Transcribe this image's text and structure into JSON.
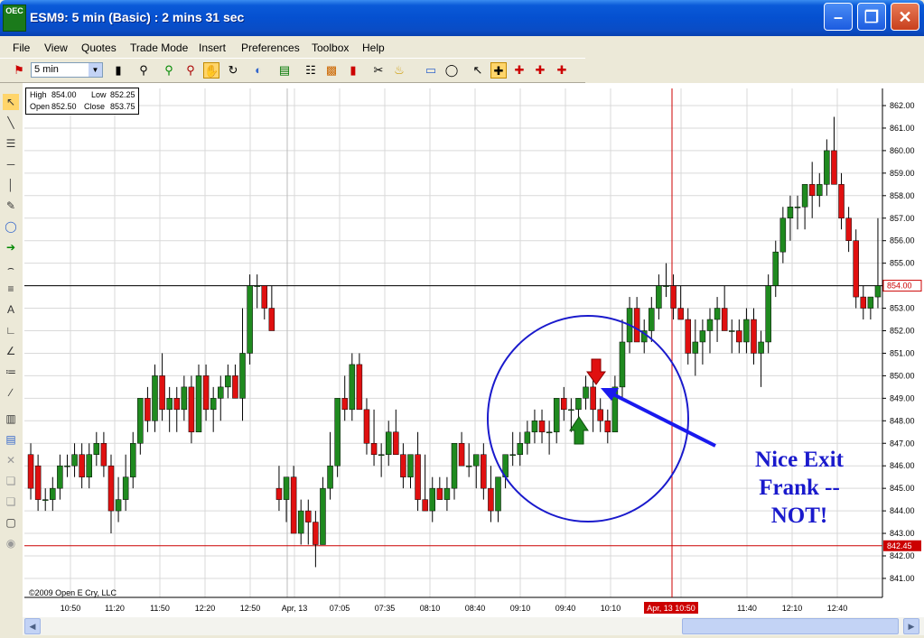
{
  "window": {
    "title": "ESM9: 5 min (Basic) : 2 mins 31 sec",
    "app_icon": "OEC",
    "minimize_label": "–",
    "maximize_label": "❐",
    "close_label": "✕"
  },
  "menu": [
    "File",
    "View",
    "Quotes",
    "Trade Mode",
    "Insert",
    "Preferences",
    "Toolbox",
    "Help"
  ],
  "toolbar": {
    "interval_value": "5 min",
    "icons": [
      "pin-icon",
      "bar-type-icon",
      "zoom-icon",
      "zoom-in-icon",
      "zoom-out-icon",
      "pan-hand-icon",
      "refresh-icon",
      "3d-icon",
      "indicator-icon",
      "tree-icon",
      "color-bars-icon",
      "histogram-icon",
      "cut-icon",
      "bell-icon",
      "trash-icon",
      "mouse-icon",
      "pointer-icon",
      "crosshair-icon",
      "crosshair-red-icon",
      "crosshair-red2-icon"
    ]
  },
  "ohlc": {
    "high_label": "High",
    "high_value": "854.00",
    "low_label": "Low",
    "low_value": "852.25",
    "open_label": "Open",
    "open_value": "852.50",
    "close_label": "Close",
    "close_value": "853.75"
  },
  "copyright": "©2009 Open E Cry, LLC",
  "annotation": [
    "Nice Exit",
    "Frank --",
    "NOT!"
  ],
  "colors": {
    "up": "#1f8a1f",
    "down": "#e01010",
    "grid": "#d9d9d9",
    "crosshair": "#cc0000",
    "annotation": "#1a1acc",
    "arrow": "#1a1aee"
  },
  "chart_data": {
    "type": "candlestick",
    "symbol": "ESM9",
    "interval": "5 min",
    "y_ticks": [
      "862.00",
      "861.00",
      "860.00",
      "859.00",
      "858.00",
      "857.00",
      "856.00",
      "855.00",
      "854.00",
      "853.00",
      "852.00",
      "851.00",
      "850.00",
      "849.00",
      "848.00",
      "847.00",
      "846.00",
      "845.00",
      "844.00",
      "843.00",
      "842.00",
      "841.00"
    ],
    "ylim": [
      840.5,
      862.5
    ],
    "x_ticks": [
      "10:50",
      "11:20",
      "11:50",
      "12:20",
      "12:50",
      "Apr, 13",
      "07:05",
      "07:35",
      "08:10",
      "08:40",
      "09:10",
      "09:40",
      "10:10",
      "10:50",
      "11:40",
      "12:10",
      "12:40"
    ],
    "x_cursor_label": "Apr, 13 10:50",
    "price_line": 854.0,
    "price_line_label": "854.00",
    "cursor_price": 842.45,
    "cursor_price_label": "842.45",
    "candles": [
      [
        846.5,
        847.0,
        844.5,
        845.0
      ],
      [
        846.0,
        846.5,
        844.0,
        844.5
      ],
      [
        844.5,
        845.0,
        844.0,
        844.5
      ],
      [
        844.5,
        845.5,
        844.0,
        845.0
      ],
      [
        845.0,
        846.5,
        844.5,
        846.0
      ],
      [
        846.0,
        846.5,
        845.5,
        846.0
      ],
      [
        846.0,
        847.0,
        845.5,
        846.5
      ],
      [
        846.5,
        847.0,
        845.0,
        845.5
      ],
      [
        845.5,
        847.0,
        845.0,
        846.5
      ],
      [
        846.5,
        847.5,
        846.0,
        847.0
      ],
      [
        847.0,
        847.5,
        845.5,
        846.0
      ],
      [
        846.0,
        846.5,
        843.0,
        844.0
      ],
      [
        844.0,
        845.5,
        843.5,
        844.5
      ],
      [
        844.5,
        846.5,
        844.0,
        845.5
      ],
      [
        845.5,
        847.5,
        845.0,
        847.0
      ],
      [
        847.0,
        849.0,
        846.5,
        849.0
      ],
      [
        849.0,
        849.5,
        847.5,
        848.0
      ],
      [
        848.0,
        850.5,
        847.5,
        850.0
      ],
      [
        850.0,
        851.0,
        848.0,
        848.5
      ],
      [
        848.5,
        849.5,
        847.5,
        849.0
      ],
      [
        849.0,
        849.5,
        847.5,
        848.5
      ],
      [
        848.5,
        850.0,
        848.0,
        849.5
      ],
      [
        849.5,
        850.0,
        847.0,
        847.5
      ],
      [
        847.5,
        850.5,
        847.5,
        850.0
      ],
      [
        850.0,
        850.5,
        848.0,
        848.5
      ],
      [
        848.5,
        849.5,
        847.5,
        849.0
      ],
      [
        849.0,
        850.0,
        848.0,
        849.5
      ],
      [
        849.5,
        850.5,
        849.0,
        850.0
      ],
      [
        850.0,
        850.5,
        849.0,
        849.0
      ],
      [
        849.0,
        853.0,
        848.0,
        851.0
      ],
      [
        851.0,
        854.5,
        850.5,
        854.0
      ],
      [
        854.0,
        854.5,
        853.0,
        854.0
      ],
      [
        854.0,
        854.0,
        852.5,
        853.0
      ],
      [
        853.0,
        854.0,
        852.0,
        852.0
      ],
      [
        845.0,
        846.0,
        844.0,
        844.5
      ],
      [
        844.5,
        845.5,
        843.5,
        845.5
      ],
      [
        845.5,
        846.0,
        843.5,
        843.0
      ],
      [
        843.0,
        844.5,
        842.5,
        844.0
      ],
      [
        844.0,
        844.5,
        842.5,
        843.5
      ],
      [
        843.5,
        844.0,
        841.5,
        842.5
      ],
      [
        842.5,
        845.5,
        842.5,
        845.0
      ],
      [
        845.0,
        847.5,
        844.5,
        846.0
      ],
      [
        846.0,
        849.0,
        845.5,
        849.0
      ],
      [
        849.0,
        850.0,
        848.0,
        848.5
      ],
      [
        848.5,
        851.0,
        848.0,
        850.5
      ],
      [
        850.5,
        851.0,
        848.5,
        848.5
      ],
      [
        848.5,
        849.0,
        846.5,
        847.0
      ],
      [
        847.0,
        848.5,
        846.0,
        846.5
      ],
      [
        846.5,
        847.0,
        845.5,
        846.5
      ],
      [
        846.5,
        848.0,
        846.0,
        847.5
      ],
      [
        847.5,
        848.5,
        846.5,
        846.5
      ],
      [
        846.5,
        847.0,
        845.0,
        845.5
      ],
      [
        845.5,
        846.5,
        845.0,
        846.5
      ],
      [
        846.5,
        847.5,
        844.0,
        844.5
      ],
      [
        844.5,
        846.5,
        844.0,
        844.0
      ],
      [
        844.0,
        845.5,
        843.5,
        845.0
      ],
      [
        845.0,
        845.5,
        844.5,
        844.5
      ],
      [
        844.5,
        845.5,
        844.0,
        845.0
      ],
      [
        845.0,
        847.0,
        844.5,
        847.0
      ],
      [
        847.0,
        847.5,
        846.0,
        846.0
      ],
      [
        846.0,
        847.0,
        845.5,
        846.0
      ],
      [
        846.0,
        846.5,
        845.0,
        846.5
      ],
      [
        846.5,
        847.0,
        844.5,
        845.0
      ],
      [
        845.0,
        846.0,
        843.5,
        844.0
      ],
      [
        844.0,
        845.5,
        843.5,
        845.5
      ],
      [
        845.5,
        846.5,
        845.0,
        846.5
      ],
      [
        846.5,
        847.5,
        846.0,
        846.5
      ],
      [
        846.5,
        847.5,
        846.0,
        847.0
      ],
      [
        847.0,
        848.0,
        846.5,
        847.5
      ],
      [
        847.5,
        848.5,
        847.0,
        848.0
      ],
      [
        848.0,
        848.5,
        847.0,
        847.5
      ],
      [
        847.5,
        848.0,
        846.5,
        847.5
      ],
      [
        847.5,
        849.0,
        847.0,
        849.0
      ],
      [
        849.0,
        849.5,
        848.0,
        848.5
      ],
      [
        848.5,
        849.0,
        847.5,
        848.5
      ],
      [
        848.5,
        849.0,
        847.5,
        849.0
      ],
      [
        849.0,
        850.0,
        848.5,
        849.5
      ],
      [
        849.5,
        850.5,
        847.5,
        848.5
      ],
      [
        848.5,
        849.0,
        847.5,
        848.0
      ],
      [
        848.0,
        848.5,
        847.0,
        847.5
      ],
      [
        847.5,
        850.0,
        847.5,
        849.5
      ],
      [
        849.5,
        852.5,
        849.0,
        851.5
      ],
      [
        851.5,
        853.5,
        851.0,
        853.0
      ],
      [
        853.0,
        853.5,
        851.5,
        851.5
      ],
      [
        851.5,
        852.5,
        851.0,
        852.0
      ],
      [
        852.0,
        853.5,
        851.5,
        853.0
      ],
      [
        853.0,
        854.5,
        852.5,
        854.0
      ],
      [
        854.0,
        855.0,
        853.5,
        854.0
      ],
      [
        854.0,
        854.5,
        852.5,
        853.0
      ],
      [
        853.0,
        854.0,
        852.5,
        852.5
      ],
      [
        852.5,
        853.0,
        850.5,
        851.0
      ],
      [
        851.0,
        852.5,
        850.0,
        851.5
      ],
      [
        851.5,
        852.5,
        850.5,
        852.0
      ],
      [
        852.0,
        853.0,
        851.0,
        852.5
      ],
      [
        852.5,
        853.5,
        851.5,
        853.0
      ],
      [
        853.0,
        854.0,
        852.0,
        852.0
      ],
      [
        852.0,
        852.5,
        851.0,
        852.0
      ],
      [
        852.0,
        852.5,
        851.0,
        851.5
      ],
      [
        851.5,
        853.0,
        851.0,
        852.5
      ],
      [
        852.5,
        853.0,
        850.5,
        851.0
      ],
      [
        851.0,
        852.0,
        849.5,
        851.5
      ],
      [
        851.5,
        854.5,
        851.0,
        854.0
      ],
      [
        854.0,
        856.0,
        853.5,
        855.5
      ],
      [
        855.5,
        857.5,
        855.0,
        857.0
      ],
      [
        857.0,
        858.0,
        856.0,
        857.5
      ],
      [
        857.5,
        858.0,
        856.5,
        857.5
      ],
      [
        857.5,
        858.5,
        856.5,
        858.5
      ],
      [
        858.5,
        859.5,
        857.0,
        858.0
      ],
      [
        858.0,
        859.0,
        857.5,
        858.5
      ],
      [
        858.5,
        860.5,
        858.0,
        860.0
      ],
      [
        860.0,
        861.5,
        858.5,
        858.5
      ],
      [
        858.5,
        859.0,
        856.5,
        857.0
      ],
      [
        857.0,
        857.5,
        855.5,
        856.0
      ],
      [
        856.0,
        856.5,
        853.0,
        853.5
      ],
      [
        853.5,
        854.0,
        852.5,
        853.0
      ],
      [
        853.0,
        853.5,
        852.5,
        853.5
      ],
      [
        853.5,
        857.0,
        853.0,
        854.0
      ]
    ]
  }
}
